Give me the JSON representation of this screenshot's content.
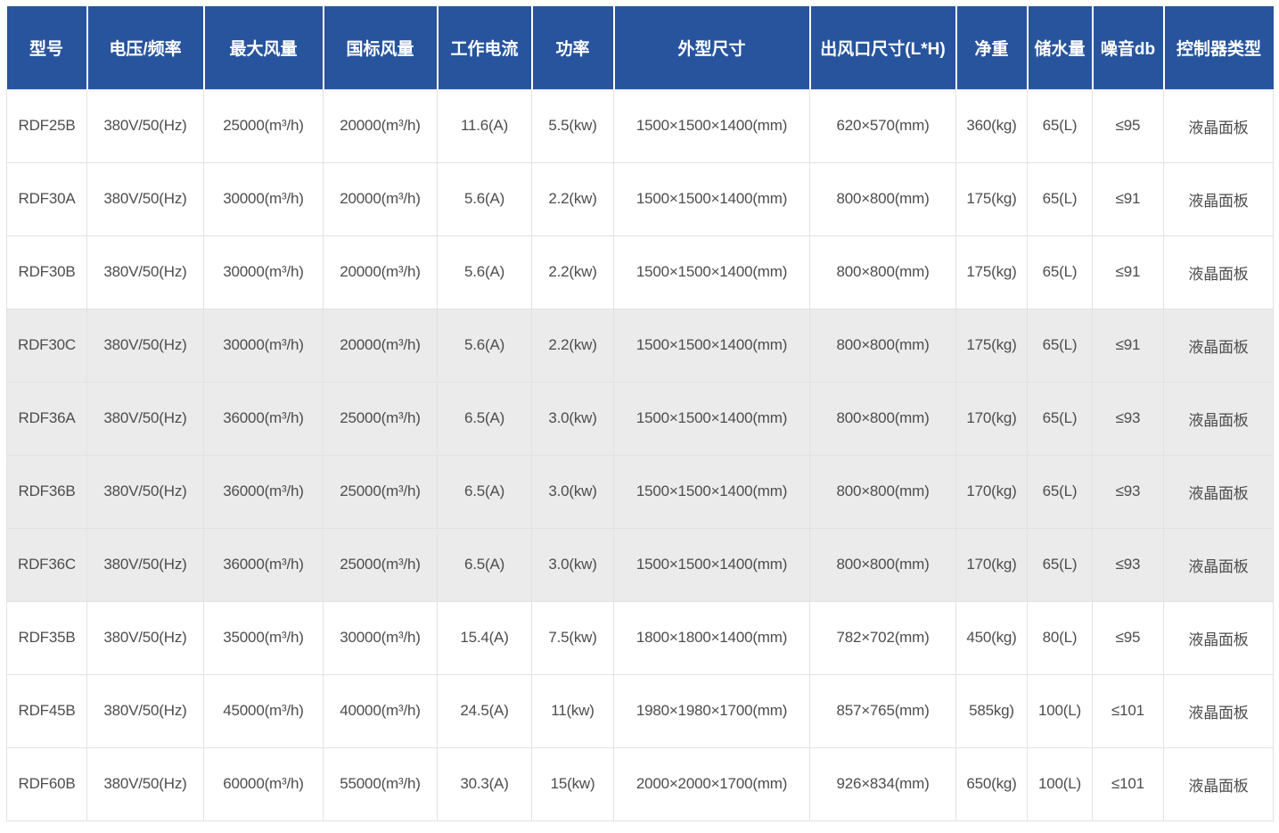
{
  "colors": {
    "header_bg": "#27549D",
    "header_text": "#FFFFFF",
    "body_text": "#4D4D4D",
    "stripe_bg": "#EBEBEB",
    "border": "#E2E2E2"
  },
  "table": {
    "columns": [
      "型号",
      "电压/频率",
      "最大风量",
      "国标风量",
      "工作电流",
      "功率",
      "外型尺寸",
      "出风口尺寸(L*H)",
      "净重",
      "储水量",
      "噪音db",
      "控制器类型"
    ],
    "striped_rows": [
      3,
      4,
      5,
      6
    ],
    "rows": [
      [
        "RDF25B",
        "380V/50(Hz)",
        "25000(m³/h)",
        "20000(m³/h)",
        "11.6(A)",
        "5.5(kw)",
        "1500×1500×1400(mm)",
        "620×570(mm)",
        "360(kg)",
        "65(L)",
        "≤95",
        "液晶面板"
      ],
      [
        "RDF30A",
        "380V/50(Hz)",
        "30000(m³/h)",
        "20000(m³/h)",
        "5.6(A)",
        "2.2(kw)",
        "1500×1500×1400(mm)",
        "800×800(mm)",
        "175(kg)",
        "65(L)",
        "≤91",
        "液晶面板"
      ],
      [
        "RDF30B",
        "380V/50(Hz)",
        "30000(m³/h)",
        "20000(m³/h)",
        "5.6(A)",
        "2.2(kw)",
        "1500×1500×1400(mm)",
        "800×800(mm)",
        "175(kg)",
        "65(L)",
        "≤91",
        "液晶面板"
      ],
      [
        "RDF30C",
        "380V/50(Hz)",
        "30000(m³/h)",
        "20000(m³/h)",
        "5.6(A)",
        "2.2(kw)",
        "1500×1500×1400(mm)",
        "800×800(mm)",
        "175(kg)",
        "65(L)",
        "≤91",
        "液晶面板"
      ],
      [
        "RDF36A",
        "380V/50(Hz)",
        "36000(m³/h)",
        "25000(m³/h)",
        "6.5(A)",
        "3.0(kw)",
        "1500×1500×1400(mm)",
        "800×800(mm)",
        "170(kg)",
        "65(L)",
        "≤93",
        "液晶面板"
      ],
      [
        "RDF36B",
        "380V/50(Hz)",
        "36000(m³/h)",
        "25000(m³/h)",
        "6.5(A)",
        "3.0(kw)",
        "1500×1500×1400(mm)",
        "800×800(mm)",
        "170(kg)",
        "65(L)",
        "≤93",
        "液晶面板"
      ],
      [
        "RDF36C",
        "380V/50(Hz)",
        "36000(m³/h)",
        "25000(m³/h)",
        "6.5(A)",
        "3.0(kw)",
        "1500×1500×1400(mm)",
        "800×800(mm)",
        "170(kg)",
        "65(L)",
        "≤93",
        "液晶面板"
      ],
      [
        "RDF35B",
        "380V/50(Hz)",
        "35000(m³/h)",
        "30000(m³/h)",
        "15.4(A)",
        "7.5(kw)",
        "1800×1800×1400(mm)",
        "782×702(mm)",
        "450(kg)",
        "80(L)",
        "≤95",
        "液晶面板"
      ],
      [
        "RDF45B",
        "380V/50(Hz)",
        "45000(m³/h)",
        "40000(m³/h)",
        "24.5(A)",
        "11(kw)",
        "1980×1980×1700(mm)",
        "857×765(mm)",
        "585kg)",
        "100(L)",
        "≤101",
        "液晶面板"
      ],
      [
        "RDF60B",
        "380V/50(Hz)",
        "60000(m³/h)",
        "55000(m³/h)",
        "30.3(A)",
        "15(kw)",
        "2000×2000×1700(mm)",
        "926×834(mm)",
        "650(kg)",
        "100(L)",
        "≤101",
        "液晶面板"
      ]
    ]
  }
}
